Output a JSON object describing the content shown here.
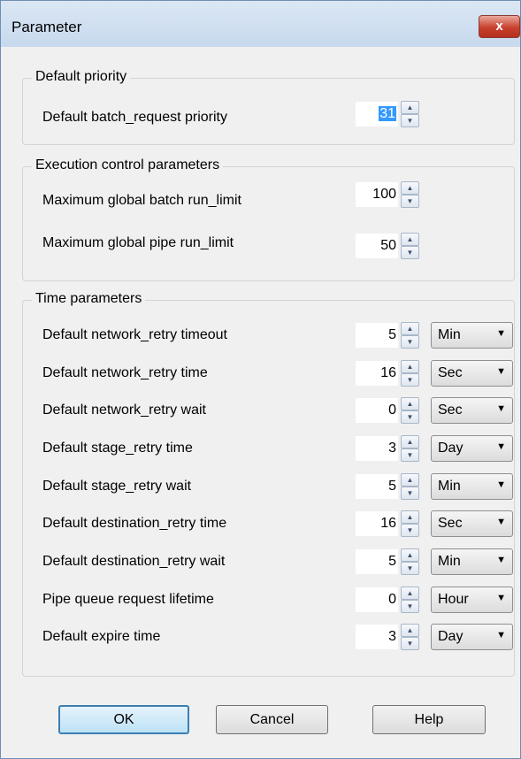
{
  "window": {
    "title": "Parameter",
    "close_glyph": "x"
  },
  "groups": {
    "default_priority": {
      "title": "Default priority",
      "rows": [
        {
          "label": "Default batch_request priority",
          "value": "31"
        }
      ]
    },
    "execution": {
      "title": "Execution control parameters",
      "rows": [
        {
          "label": "Maximum global batch run_limit",
          "value": "100"
        },
        {
          "label": "Maximum global pipe run_limit",
          "value": "50"
        }
      ]
    },
    "time": {
      "title": "Time parameters",
      "rows": [
        {
          "label": "Default network_retry timeout",
          "value": "5",
          "unit": "Min"
        },
        {
          "label": "Default network_retry time",
          "value": "16",
          "unit": "Sec"
        },
        {
          "label": "Default network_retry wait",
          "value": "0",
          "unit": "Sec"
        },
        {
          "label": "Default stage_retry time",
          "value": "3",
          "unit": "Day"
        },
        {
          "label": "Default stage_retry wait",
          "value": "5",
          "unit": "Min"
        },
        {
          "label": "Default destination_retry time",
          "value": "16",
          "unit": "Sec"
        },
        {
          "label": "Default destination_retry wait",
          "value": "5",
          "unit": "Min"
        },
        {
          "label": "Pipe queue request lifetime",
          "value": "0",
          "unit": "Hour"
        },
        {
          "label": "Default expire time",
          "value": "3",
          "unit": "Day"
        }
      ]
    }
  },
  "buttons": {
    "ok": "OK",
    "cancel": "Cancel",
    "help": "Help"
  },
  "glyphs": {
    "up": "▲",
    "down": "▼",
    "dropdown": "▼"
  },
  "colors": {
    "selection": "#3399ff",
    "titlebar": "#c7d9ee",
    "close": "#c8402e"
  }
}
